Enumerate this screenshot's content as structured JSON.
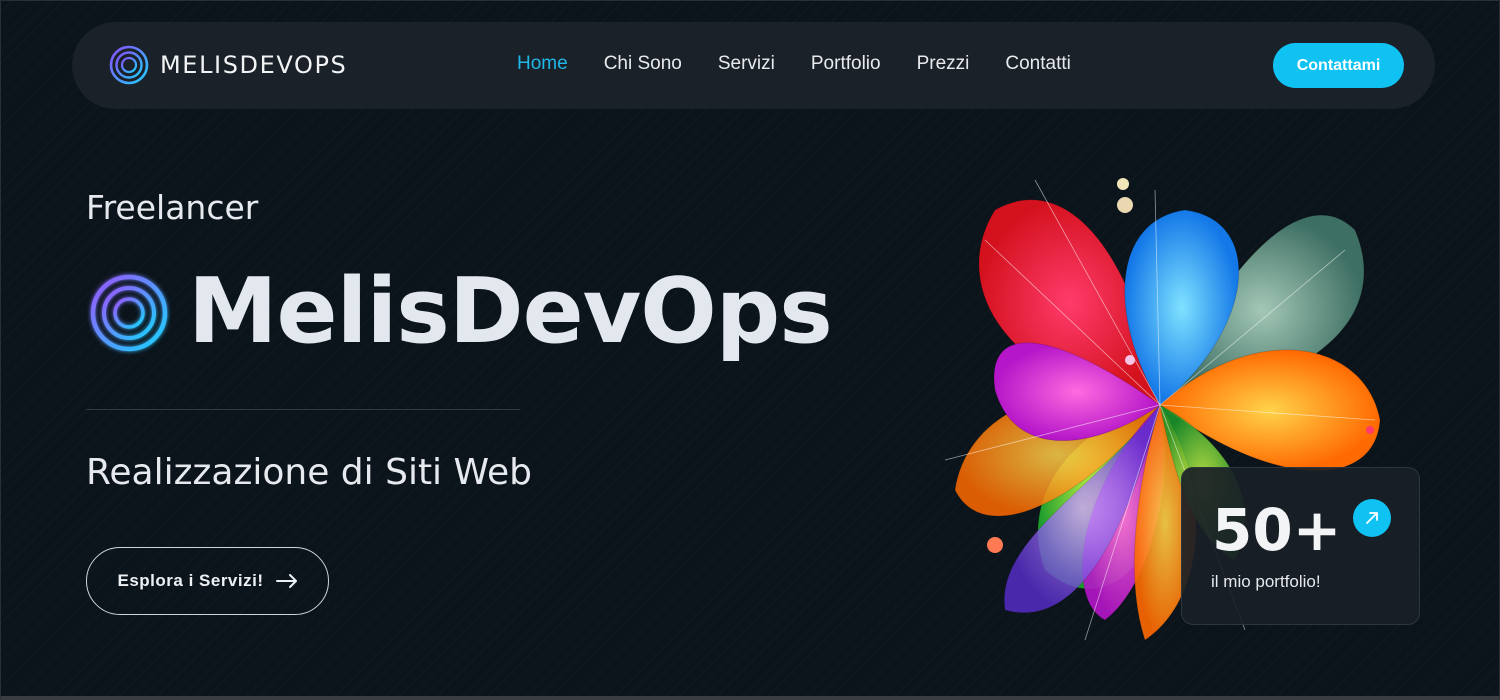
{
  "brand": {
    "name": "MELISDEVOPS",
    "logo_icon": "concentric-rings-logo-icon"
  },
  "nav": {
    "links": [
      {
        "label": "Home",
        "active": true
      },
      {
        "label": "Chi Sono",
        "active": false
      },
      {
        "label": "Servizi",
        "active": false
      },
      {
        "label": "Portfolio",
        "active": false
      },
      {
        "label": "Prezzi",
        "active": false
      },
      {
        "label": "Contatti",
        "active": false
      }
    ],
    "cta_label": "Contattami"
  },
  "hero": {
    "eyebrow": "Freelancer",
    "title": "MelisDevOps",
    "subtitle": "Realizzazione di Siti Web",
    "button_label": "Esplora i Servizi!",
    "button_icon": "arrow-right-icon"
  },
  "stat": {
    "value": "50+",
    "label": "il mio portfolio!",
    "icon": "arrow-up-right-icon"
  },
  "colors": {
    "accent": "#10c2f2",
    "background": "#0b141b",
    "nav_bg": "#1a2128",
    "active_link": "#1fb7e8"
  }
}
